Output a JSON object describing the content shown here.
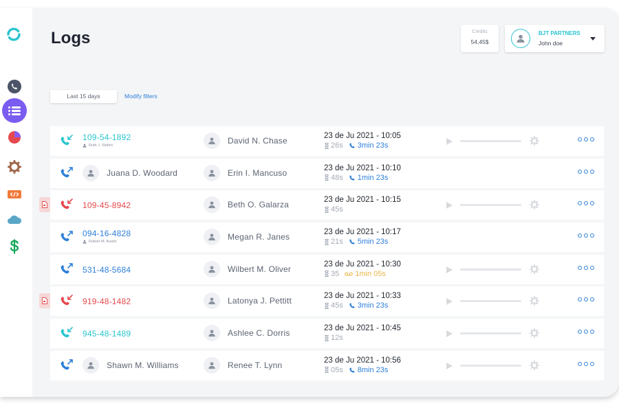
{
  "page": {
    "title": "Logs"
  },
  "sidebar": {
    "items": [
      {
        "name": "phone-icon",
        "active": false
      },
      {
        "name": "list-icon",
        "active": true
      },
      {
        "name": "pie-chart-icon",
        "active": false
      },
      {
        "name": "gear-icon",
        "active": false
      },
      {
        "name": "code-icon",
        "active": false
      },
      {
        "name": "cloud-icon",
        "active": false
      },
      {
        "name": "dollar-icon",
        "active": false
      }
    ]
  },
  "header": {
    "credits_label": "Credits",
    "credits_value": "54,45$",
    "account_org": "BJT PARTNERS",
    "account_user": "John doe"
  },
  "filters": {
    "range_label": "Last 15 days",
    "modify_label": "Modify filters"
  },
  "colors": {
    "accent": "#2bc4cf",
    "link": "#2d7fd8",
    "missed": "#e5484d",
    "nav_active": "#7a5cf0",
    "voicemail": "#e8b54a"
  },
  "logs": [
    {
      "direction": "incoming",
      "status": "answered",
      "number": "109-54-1892",
      "sub": "Ruth J. Siefert",
      "caller": "",
      "callee": "David N. Chase",
      "date": "23 de Ju 2021 - 10:05",
      "duration": "26s",
      "talk": "3min 23s",
      "talk_type": "call",
      "flag": false,
      "recording": true
    },
    {
      "direction": "outgoing",
      "status": "answered",
      "number": "",
      "sub": "",
      "caller": "Juana D. Woodard",
      "callee": "Erin I. Mancuso",
      "date": "23 de Ju 2021 - 10:10",
      "duration": "48s",
      "talk": "1min 23s",
      "talk_type": "call",
      "flag": false,
      "recording": false
    },
    {
      "direction": "incoming",
      "status": "missed",
      "number": "109-45-8942",
      "sub": "",
      "caller": "",
      "callee": "Beth O. Galarza",
      "date": "23 de Ju 2021 - 10:15",
      "duration": "45s",
      "talk": "",
      "talk_type": "",
      "flag": true,
      "recording": true
    },
    {
      "direction": "outgoing",
      "status": "answered",
      "number": "094-16-4828",
      "sub": "Robert M. Austin",
      "caller": "",
      "callee": "Megan R. Janes",
      "date": "23 de Ju 2021 - 10:17",
      "duration": "21s",
      "talk": "5min 23s",
      "talk_type": "call",
      "flag": false,
      "recording": false
    },
    {
      "direction": "outgoing",
      "status": "answered",
      "number": "531-48-5684",
      "sub": "",
      "caller": "",
      "callee": "Wilbert M. Oliver",
      "date": "23 de Ju 2021 - 10:30",
      "duration": "35",
      "talk": "1min 05s",
      "talk_type": "voicemail",
      "flag": false,
      "recording": true
    },
    {
      "direction": "incoming",
      "status": "missed",
      "number": "919-48-1482",
      "sub": "",
      "caller": "",
      "callee": "Latonya J. Pettitt",
      "date": "23 de Ju 2021 - 10:33",
      "duration": "45s",
      "talk": "3min 23s",
      "talk_type": "call",
      "flag": true,
      "recording": true
    },
    {
      "direction": "incoming",
      "status": "answered",
      "number": "945-48-1489",
      "sub": "",
      "caller": "",
      "callee": "Ashlee C. Dorris",
      "date": "23 de Ju 2021 - 10:45",
      "duration": "12s",
      "talk": "",
      "talk_type": "",
      "flag": false,
      "recording": true
    },
    {
      "direction": "outgoing",
      "status": "answered",
      "number": "",
      "sub": "",
      "caller": "Shawn M. Williams",
      "callee": "Renee T. Lynn",
      "date": "23 de Ju 2021 - 10:56",
      "duration": "05s",
      "talk": "8min 23s",
      "talk_type": "call",
      "flag": false,
      "recording": true
    }
  ]
}
